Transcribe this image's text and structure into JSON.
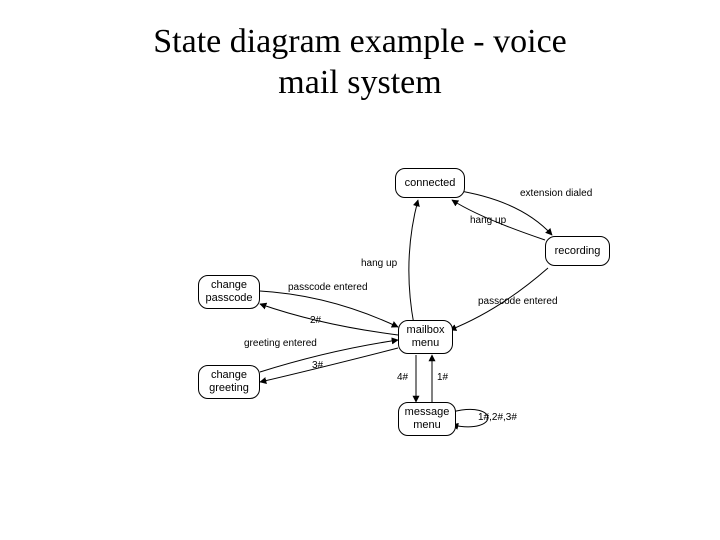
{
  "title_line1": "State diagram example - voice",
  "title_line2": "mail system",
  "states": {
    "connected": "connected",
    "recording": "recording",
    "change_passcode": "change\npasscode",
    "mailbox_menu": "mailbox\nmenu",
    "change_greeting": "change\ngreeting",
    "message_menu": "message\nmenu"
  },
  "edges": {
    "extension_dialed": "extension dialed",
    "hang_up_rec": "hang up",
    "hang_up_mb": "hang up",
    "passcode_entered_rec": "passcode entered",
    "passcode_entered_cp": "passcode entered",
    "two_hash": "2#",
    "three_hash": "3#",
    "four_hash": "4#",
    "one_hash": "1#",
    "greeting_entered": "greeting entered",
    "mm_self": "1#,2#,3#"
  }
}
